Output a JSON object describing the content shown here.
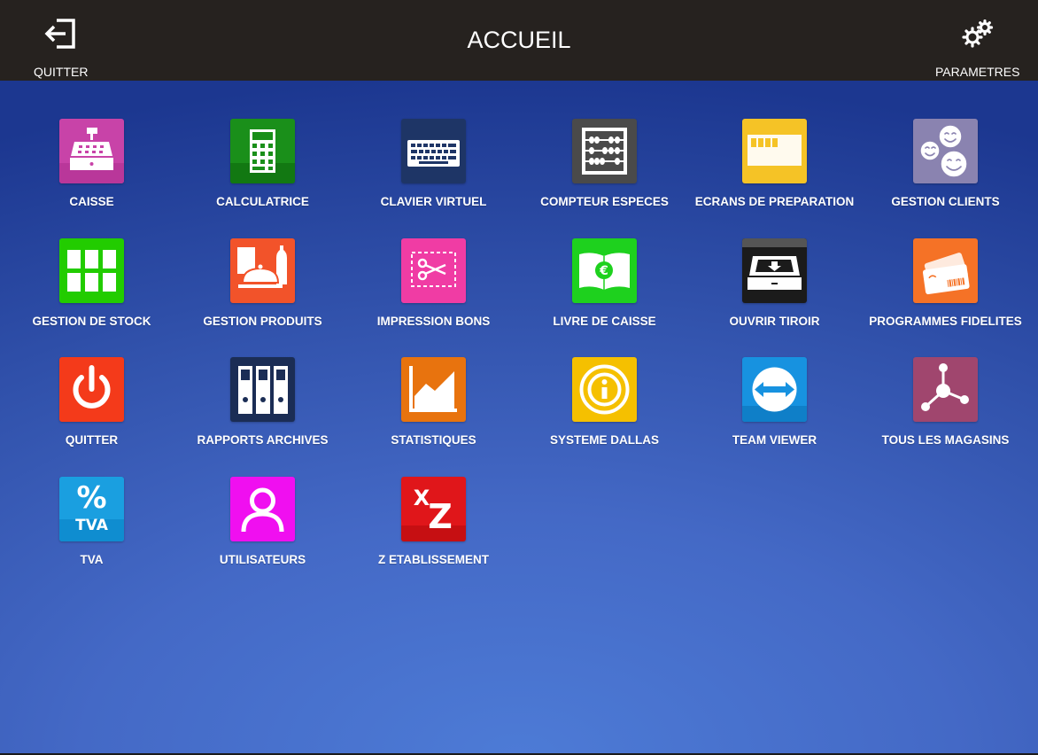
{
  "header": {
    "title": "ACCUEIL",
    "quit_label": "QUITTER",
    "settings_label": "PARAMETRES"
  },
  "apps": [
    {
      "label": "CAISSE",
      "icon": "cash-register-icon",
      "color": "#c843a8"
    },
    {
      "label": "CALCULATRICE",
      "icon": "calculator-icon",
      "color": "#1a8f1a"
    },
    {
      "label": "CLAVIER VIRTUEL",
      "icon": "keyboard-icon",
      "color": "#1e3566"
    },
    {
      "label": "COMPTEUR ESPECES",
      "icon": "abacus-icon",
      "color": "#4a4a4a"
    },
    {
      "label": "ECRANS DE PREPARATION",
      "icon": "preparation-screen-icon",
      "color": "#f5c326"
    },
    {
      "label": "GESTION CLIENTS",
      "icon": "customers-icon",
      "color": "#8a83b0"
    },
    {
      "label": "GESTION DE STOCK",
      "icon": "stock-grid-icon",
      "color": "#22cc00"
    },
    {
      "label": "GESTION PRODUITS",
      "icon": "products-cloche-icon",
      "color": "#f2532a"
    },
    {
      "label": "IMPRESSION BONS",
      "icon": "coupon-scissors-icon",
      "color": "#f03ca4"
    },
    {
      "label": "LIVRE DE CAISSE",
      "icon": "cash-book-euro-icon",
      "color": "#1ed11e"
    },
    {
      "label": "OUVRIR TIROIR",
      "icon": "cash-drawer-icon",
      "color": "#1b1b1b"
    },
    {
      "label": "PROGRAMMES FIDELITES",
      "icon": "loyalty-cards-icon",
      "color": "#f57226"
    },
    {
      "label": "QUITTER",
      "icon": "power-icon",
      "color": "#f43a1a"
    },
    {
      "label": "RAPPORTS ARCHIVES",
      "icon": "binders-icon",
      "color": "#1b2d55"
    },
    {
      "label": "STATISTIQUES",
      "icon": "area-chart-icon",
      "color": "#e8730e"
    },
    {
      "label": "SYSTEME DALLAS",
      "icon": "dallas-key-icon",
      "color": "#f5c000"
    },
    {
      "label": "TEAM VIEWER",
      "icon": "teamviewer-icon",
      "color": "#1792e0"
    },
    {
      "label": "TOUS LES MAGASINS",
      "icon": "network-icon",
      "color": "#a0466e"
    },
    {
      "label": "TVA",
      "icon": "percent-tva-icon",
      "color": "#1a9fe0"
    },
    {
      "label": "UTILISATEURS",
      "icon": "user-icon",
      "color": "#f00ff0"
    },
    {
      "label": "Z ETABLISSEMENT",
      "icon": "xz-report-icon",
      "color": "#e0161a"
    }
  ]
}
